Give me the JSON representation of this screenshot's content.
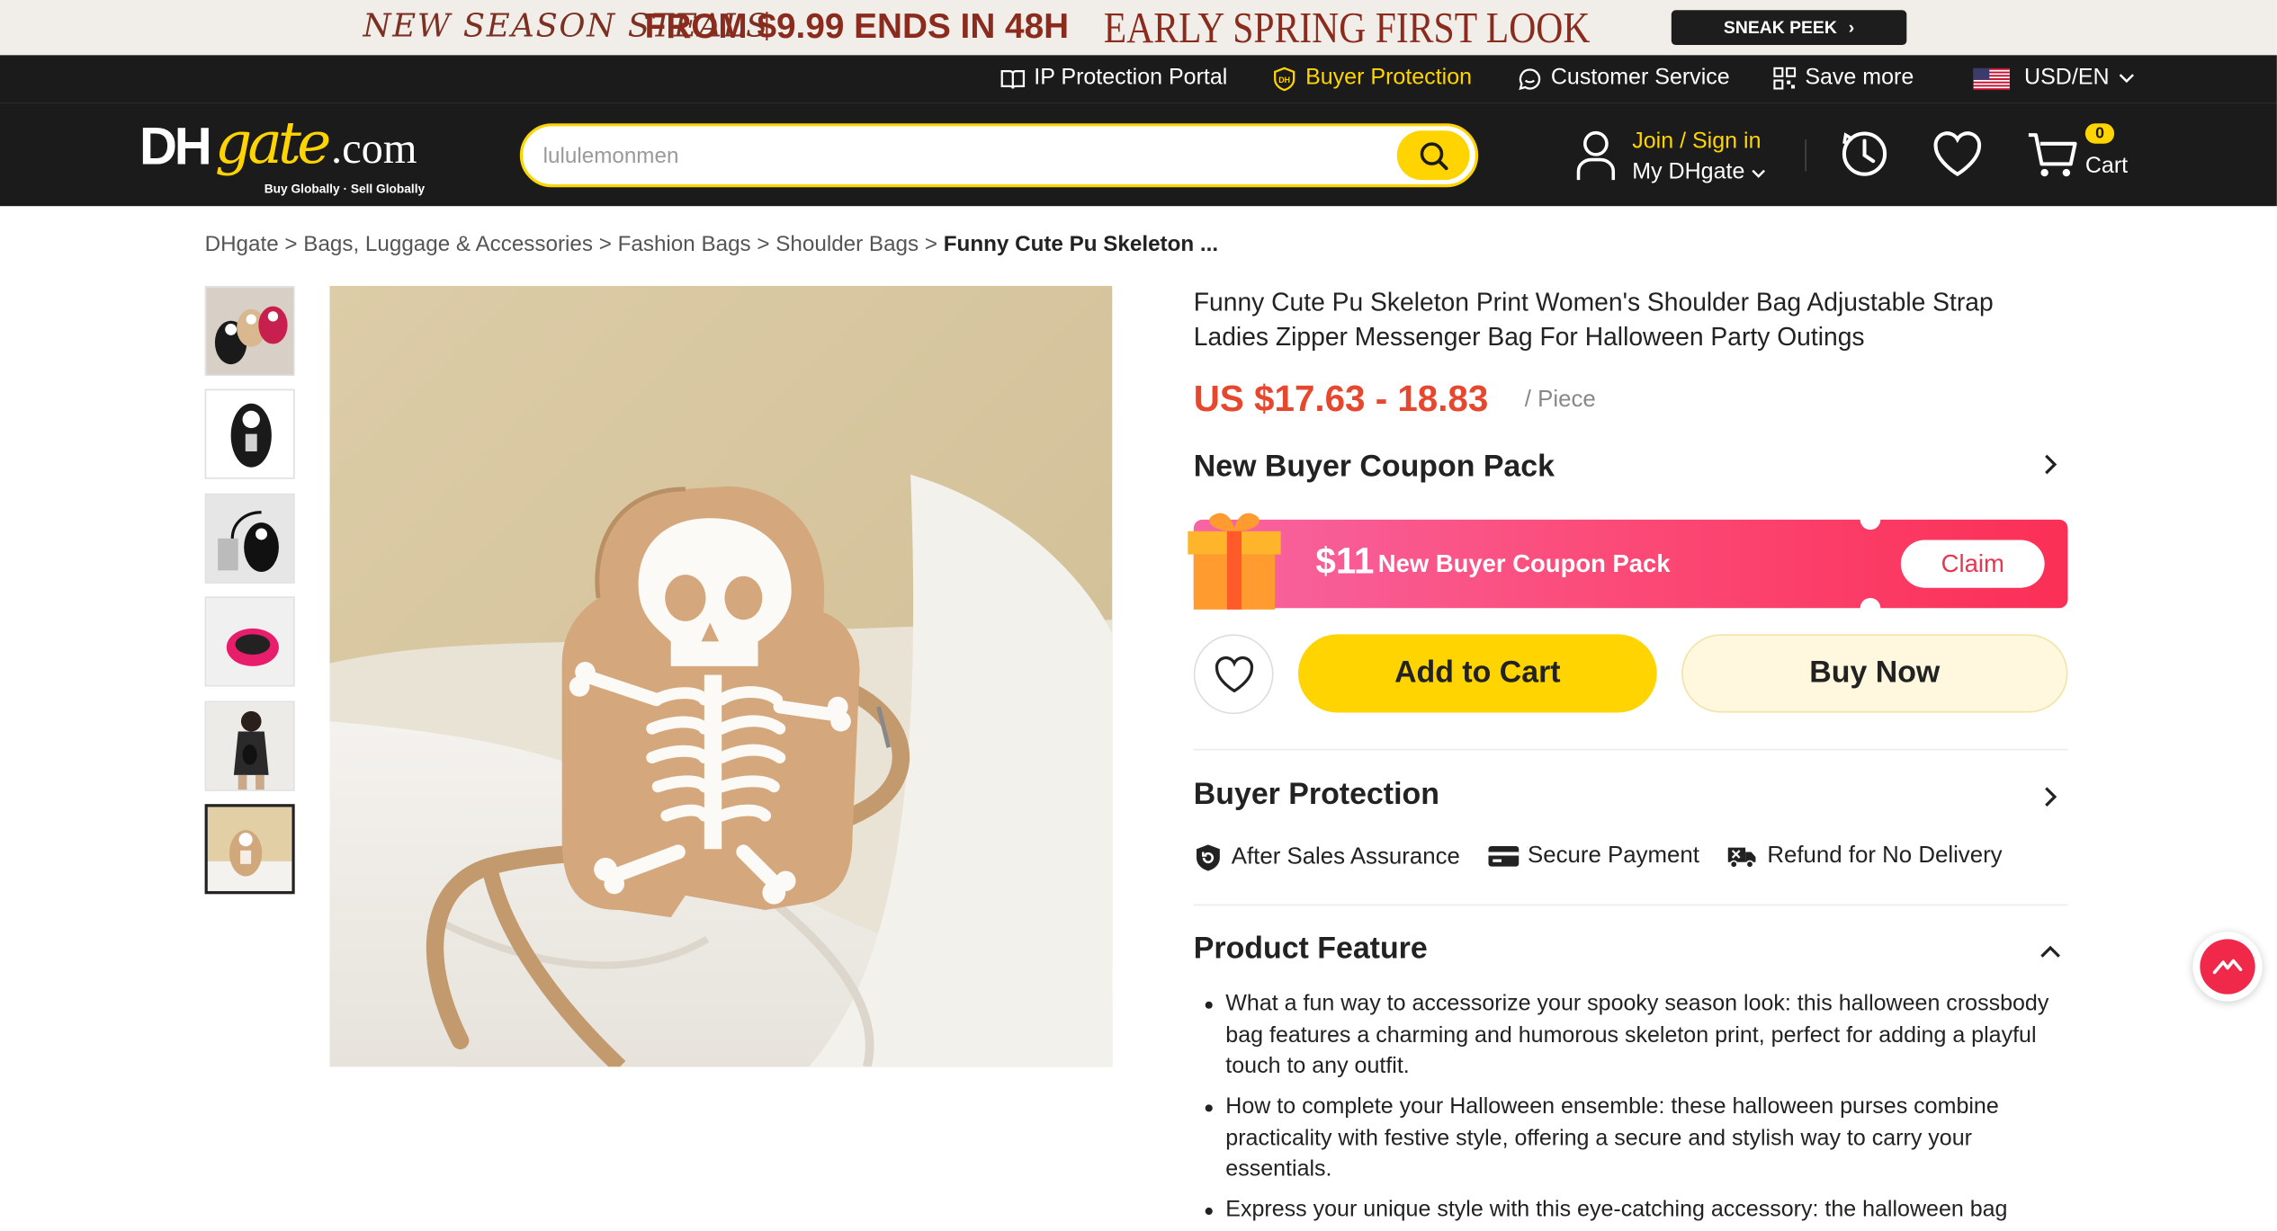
{
  "promo": {
    "left_text": "NEW SEASON STEALS",
    "middle_text": "FROM $9.99 ENDS IN 48H",
    "right_text": "EARLY SPRING FIRST LOOK",
    "cta": "SNEAK PEEK"
  },
  "topbar": {
    "ip_portal": "IP Protection Portal",
    "buyer_protection": "Buyer Protection",
    "customer_service": "Customer Service",
    "save_more": "Save more",
    "currency_lang": "USD/EN"
  },
  "header": {
    "logo_main": "DH",
    "logo_gate": "gate",
    "logo_com": ".com",
    "logo_tagline": "Buy Globally · Sell Globally",
    "search_placeholder": "lululemonmen",
    "join_signin": "Join / Sign in",
    "my_dhgate": "My DHgate",
    "cart_count": "0",
    "cart_label": "Cart"
  },
  "breadcrumb": {
    "items": [
      "DHgate",
      "Bags, Luggage & Accessories",
      "Fashion Bags",
      "Shoulder Bags"
    ],
    "current": "Funny Cute Pu Skeleton ...",
    "separator": " > "
  },
  "product": {
    "title": "Funny Cute Pu Skeleton Print Women's Shoulder Bag Adjustable Strap Ladies Zipper Messenger Bag For Halloween Party Outings",
    "price": "US $17.63 - 18.83",
    "unit": "/ Piece"
  },
  "coupon": {
    "section_title": "New Buyer Coupon Pack",
    "amount": "$11",
    "label": "New Buyer Coupon Pack",
    "claim": "Claim"
  },
  "actions": {
    "add_to_cart": "Add to Cart",
    "buy_now": "Buy Now"
  },
  "buyer_protection": {
    "title": "Buyer Protection",
    "items": [
      "After Sales Assurance",
      "Secure Payment",
      "Refund for No Delivery"
    ]
  },
  "product_feature": {
    "title": "Product Feature",
    "bullets": [
      "What a fun way to accessorize your spooky season look: this halloween crossbody bag features a charming and humorous skeleton print, perfect for adding a playful touch to any outfit.",
      "How to complete your Halloween ensemble: these halloween purses combine practicality with festive style, offering a secure and stylish way to carry your essentials.",
      "Express your unique style with this eye-catching accessory: the halloween bag"
    ]
  },
  "colors": {
    "brand_yellow": "#ffd400",
    "header_bg": "#1b1b1b",
    "price_red": "#e5482f",
    "coupon_pink": "#fb4c7a"
  }
}
